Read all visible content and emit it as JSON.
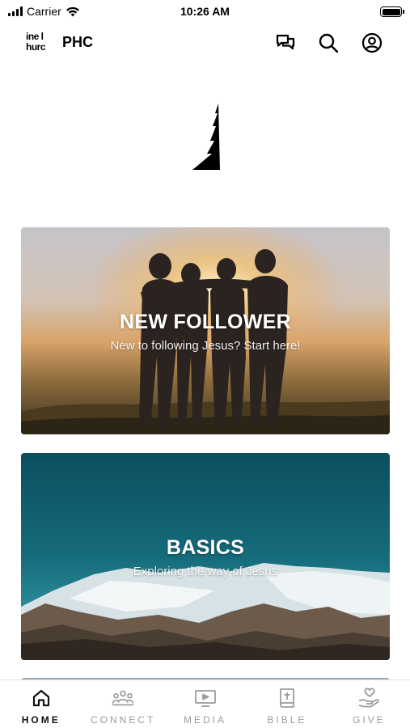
{
  "status_bar": {
    "carrier": "Carrier",
    "time": "10:26 AM"
  },
  "header": {
    "logo_text_line1": "ine l",
    "logo_text_line2": "hurc",
    "title": "PHC",
    "icons": [
      "chat-icon",
      "search-icon",
      "profile-icon"
    ]
  },
  "cards": [
    {
      "title": "NEW FOLLOWER",
      "subtitle": "New to following Jesus? Start here!"
    },
    {
      "title": "BASICS",
      "subtitle": "Exploring the way of Jesus"
    }
  ],
  "tabs": [
    {
      "label": "HOME",
      "icon": "home-icon",
      "active": true
    },
    {
      "label": "CONNECT",
      "icon": "people-icon",
      "active": false
    },
    {
      "label": "MEDIA",
      "icon": "media-icon",
      "active": false
    },
    {
      "label": "BIBLE",
      "icon": "bible-icon",
      "active": false
    },
    {
      "label": "GIVE",
      "icon": "give-icon",
      "active": false
    }
  ],
  "colors": {
    "active_tab": "#111111",
    "inactive_tab": "#9c9c9c",
    "basics_sky": "#0e5b6b",
    "follower_sunset": "#e8a24a"
  }
}
